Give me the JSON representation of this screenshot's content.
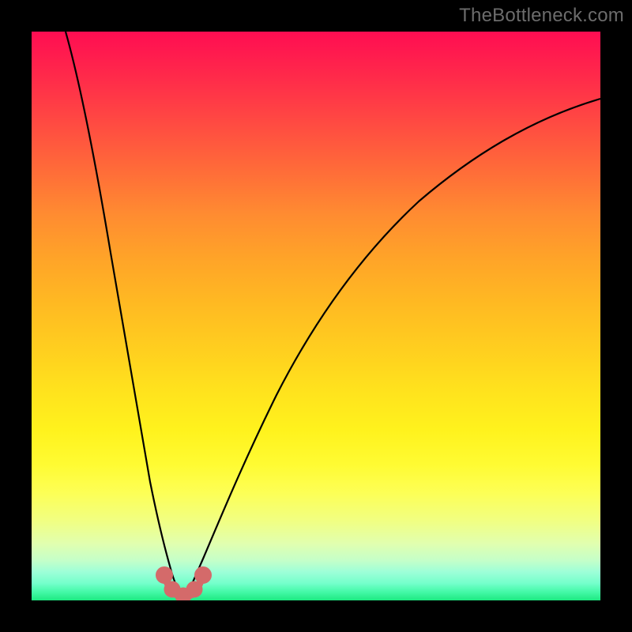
{
  "watermark": "TheBottleneck.com",
  "chart_data": {
    "type": "line",
    "title": "",
    "xlabel": "",
    "ylabel": "",
    "xlim": [
      0,
      100
    ],
    "ylim": [
      0,
      100
    ],
    "grid": false,
    "series": [
      {
        "name": "left-curve",
        "x": [
          6,
          8,
          10,
          12,
          14,
          16,
          18,
          20,
          21,
          22,
          23,
          24,
          25,
          26
        ],
        "values": [
          100,
          92,
          82,
          71,
          58.5,
          45,
          31.5,
          18,
          11.5,
          7,
          4.5,
          2.7,
          1.6,
          0.9
        ]
      },
      {
        "name": "right-curve",
        "x": [
          28,
          29,
          30,
          31,
          32,
          34,
          36,
          40,
          45,
          50,
          55,
          60,
          65,
          70,
          75,
          80,
          85,
          90,
          95,
          100
        ],
        "values": [
          1.0,
          1.8,
          3.0,
          4.5,
          6.5,
          11.5,
          17,
          27,
          38,
          47,
          54.5,
          61,
          66.5,
          71,
          75,
          78.3,
          81.2,
          83.8,
          86,
          88
        ]
      },
      {
        "name": "red-marker-cluster",
        "x": [
          23,
          24.5,
          25,
          25.5,
          26,
          27,
          27.5,
          28,
          29,
          30
        ],
        "values": [
          4.5,
          2.0,
          1.5,
          1.2,
          1.0,
          1.0,
          1.2,
          1.5,
          2.2,
          4.0
        ]
      }
    ],
    "colors": {
      "curve": "#000000",
      "marker_fill": "#d46a6a",
      "marker_stroke": "#d46a6a",
      "background_top": "#ff0d52",
      "background_bottom": "#1de981"
    }
  }
}
